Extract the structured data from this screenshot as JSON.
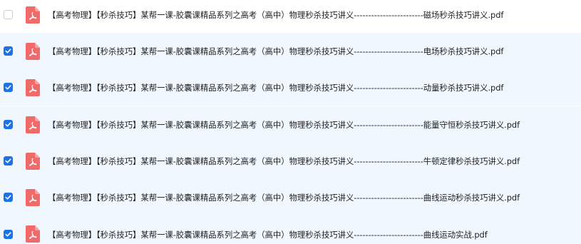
{
  "files": [
    {
      "name": "【高考物理】【秒杀技巧】某帮一课-胶囊课精品系列之高考（高中）物理秒杀技巧讲义------------------------磁场秒杀技巧讲义.pdf",
      "checked": false,
      "icon": "pdf-icon"
    },
    {
      "name": "【高考物理】【秒杀技巧】某帮一课-胶囊课精品系列之高考（高中）物理秒杀技巧讲义------------------------电场秒杀技巧讲义.pdf",
      "checked": true,
      "icon": "pdf-icon"
    },
    {
      "name": "【高考物理】【秒杀技巧】某帮一课-胶囊课精品系列之高考（高中）物理秒杀技巧讲义------------------------动量秒杀技巧讲义.pdf",
      "checked": true,
      "icon": "pdf-icon"
    },
    {
      "name": "【高考物理】【秒杀技巧】某帮一课-胶囊课精品系列之高考（高中）物理秒杀技巧讲义------------------------能量守恒秒杀技巧讲义.pdf",
      "checked": true,
      "icon": "pdf-icon"
    },
    {
      "name": "【高考物理】【秒杀技巧】某帮一课-胶囊课精品系列之高考（高中）物理秒杀技巧讲义------------------------牛顿定律秒杀技巧讲义.pdf",
      "checked": true,
      "icon": "pdf-icon"
    },
    {
      "name": "【高考物理】【秒杀技巧】某帮一课-胶囊课精品系列之高考（高中）物理秒杀技巧讲义------------------------曲线运动秒杀技巧讲义.pdf",
      "checked": true,
      "icon": "pdf-icon"
    },
    {
      "name": "【高考物理】【秒杀技巧】某帮一课-胶囊课精品系列之高考（高中）物理秒杀技巧讲义------------------------曲线运动实战.pdf",
      "checked": true,
      "icon": "pdf-icon"
    }
  ],
  "colors": {
    "accent": "#1a73e8",
    "selected_row_bg": "#f1f7ff",
    "pdf_icon": "#f06a6a"
  }
}
